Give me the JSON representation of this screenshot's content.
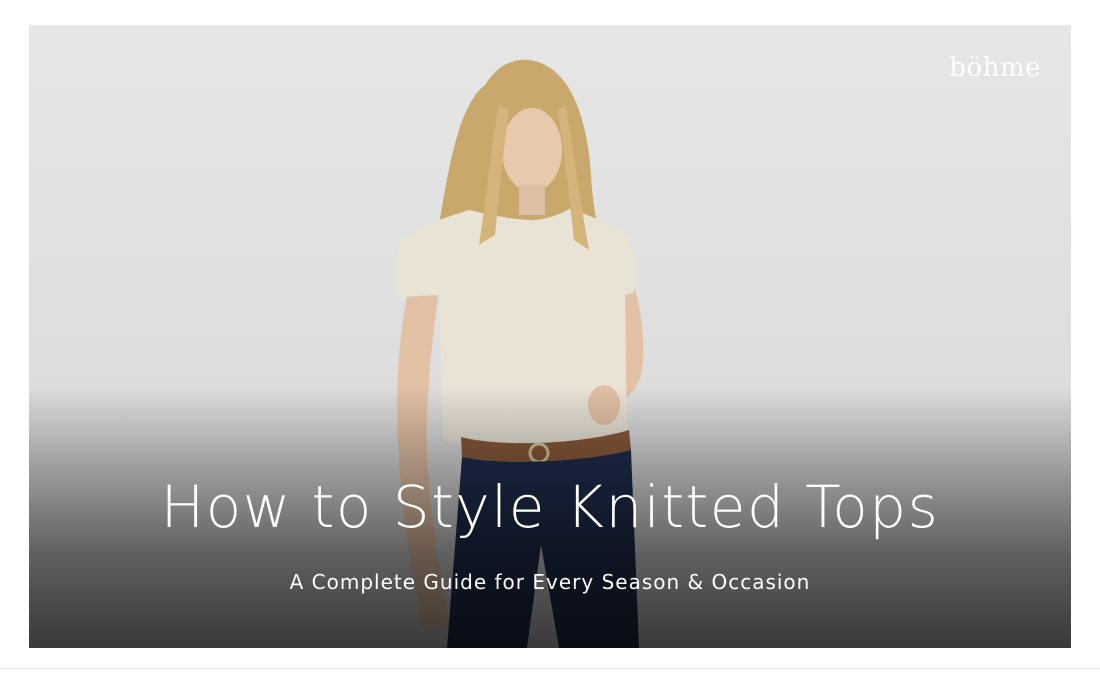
{
  "hero": {
    "brand": "böhme",
    "title": "How to Style Knitted Tops",
    "subtitle": "A Complete Guide for Every Season & Occasion"
  },
  "colors": {
    "background": "#ffffff",
    "studio_backdrop": "#e2e2e2",
    "text": "#ffffff",
    "knit_top": "#e9e3d6",
    "denim": "#1f2d4d",
    "belt": "#8a5a3a",
    "hair": "#c9a96b"
  }
}
